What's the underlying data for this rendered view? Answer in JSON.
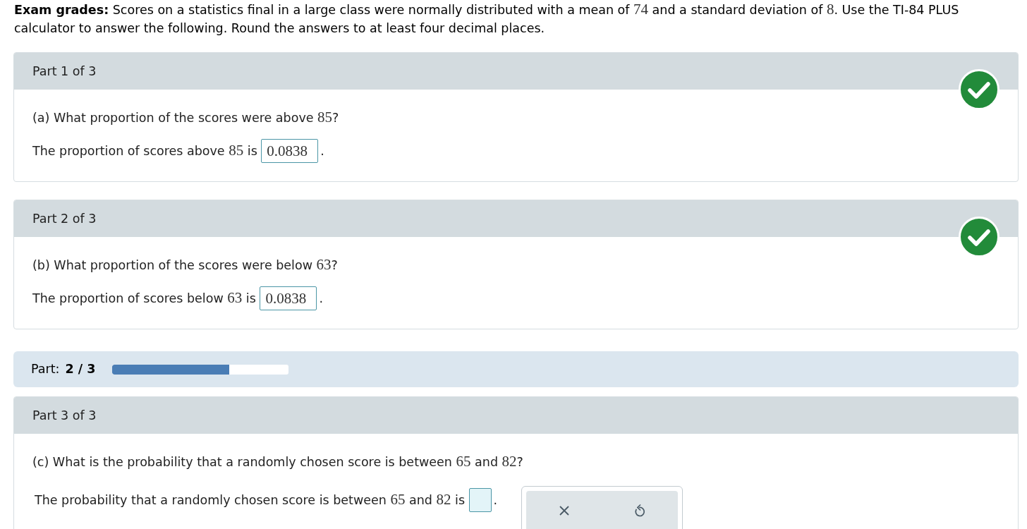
{
  "problem": [
    {
      "kind": "text",
      "text": "**Exam grades:** Scores on a statistics final in a large class were normally distributed with a mean of "
    },
    {
      "kind": "math",
      "text": "74"
    },
    {
      "kind": "text",
      "text": " and a standard deviation of "
    },
    {
      "kind": "math",
      "text": "8"
    },
    {
      "kind": "text",
      "text": ". Use the TI-84 PLUS calculator to answer the following. Round the answers to at least four decimal places."
    }
  ],
  "sections": [
    {
      "kind": "part",
      "title": "Part 1 of 3",
      "correct": true,
      "question": [
        {
          "kind": "text",
          "text": "(a) What proportion of the scores were above "
        },
        {
          "kind": "math",
          "text": "85"
        },
        {
          "kind": "text",
          "text": "?"
        }
      ],
      "answer": {
        "segments": [
          {
            "kind": "text",
            "text": "The proportion of scores above "
          },
          {
            "kind": "math",
            "text": "85"
          },
          {
            "kind": "text",
            "text": " is "
          }
        ],
        "value": "0.0838",
        "focused": false,
        "after": "."
      }
    },
    {
      "kind": "part",
      "title": "Part 2 of 3",
      "correct": true,
      "question": [
        {
          "kind": "text",
          "text": "(b) What proportion of the scores were below "
        },
        {
          "kind": "math",
          "text": "63"
        },
        {
          "kind": "text",
          "text": "?"
        }
      ],
      "answer": {
        "segments": [
          {
            "kind": "text",
            "text": "The proportion of scores below "
          },
          {
            "kind": "math",
            "text": "63"
          },
          {
            "kind": "text",
            "text": " is "
          }
        ],
        "value": "0.0838",
        "focused": false,
        "after": "."
      }
    },
    {
      "kind": "progress",
      "label": "Part:",
      "value": "2 / 3",
      "level": 0.664
    },
    {
      "kind": "part",
      "title": "Part 3 of 3",
      "correct": false,
      "question": [
        {
          "kind": "text",
          "text": "(c) What is the probability that a randomly chosen score is between "
        },
        {
          "kind": "math",
          "text": "65"
        },
        {
          "kind": "text",
          "text": " and "
        },
        {
          "kind": "math",
          "text": "82"
        },
        {
          "kind": "text",
          "text": "?"
        }
      ],
      "answer": {
        "segments": [
          {
            "kind": "text",
            "text": "The probability that a randomly chosen score is between "
          },
          {
            "kind": "math",
            "text": "65"
          },
          {
            "kind": "text",
            "text": " and "
          },
          {
            "kind": "math",
            "text": "82"
          },
          {
            "kind": "text",
            "text": " is "
          }
        ],
        "focused": true,
        "after": "."
      },
      "toolbar": [
        {
          "kind": "clear"
        },
        {
          "kind": "undo"
        }
      ]
    }
  ]
}
